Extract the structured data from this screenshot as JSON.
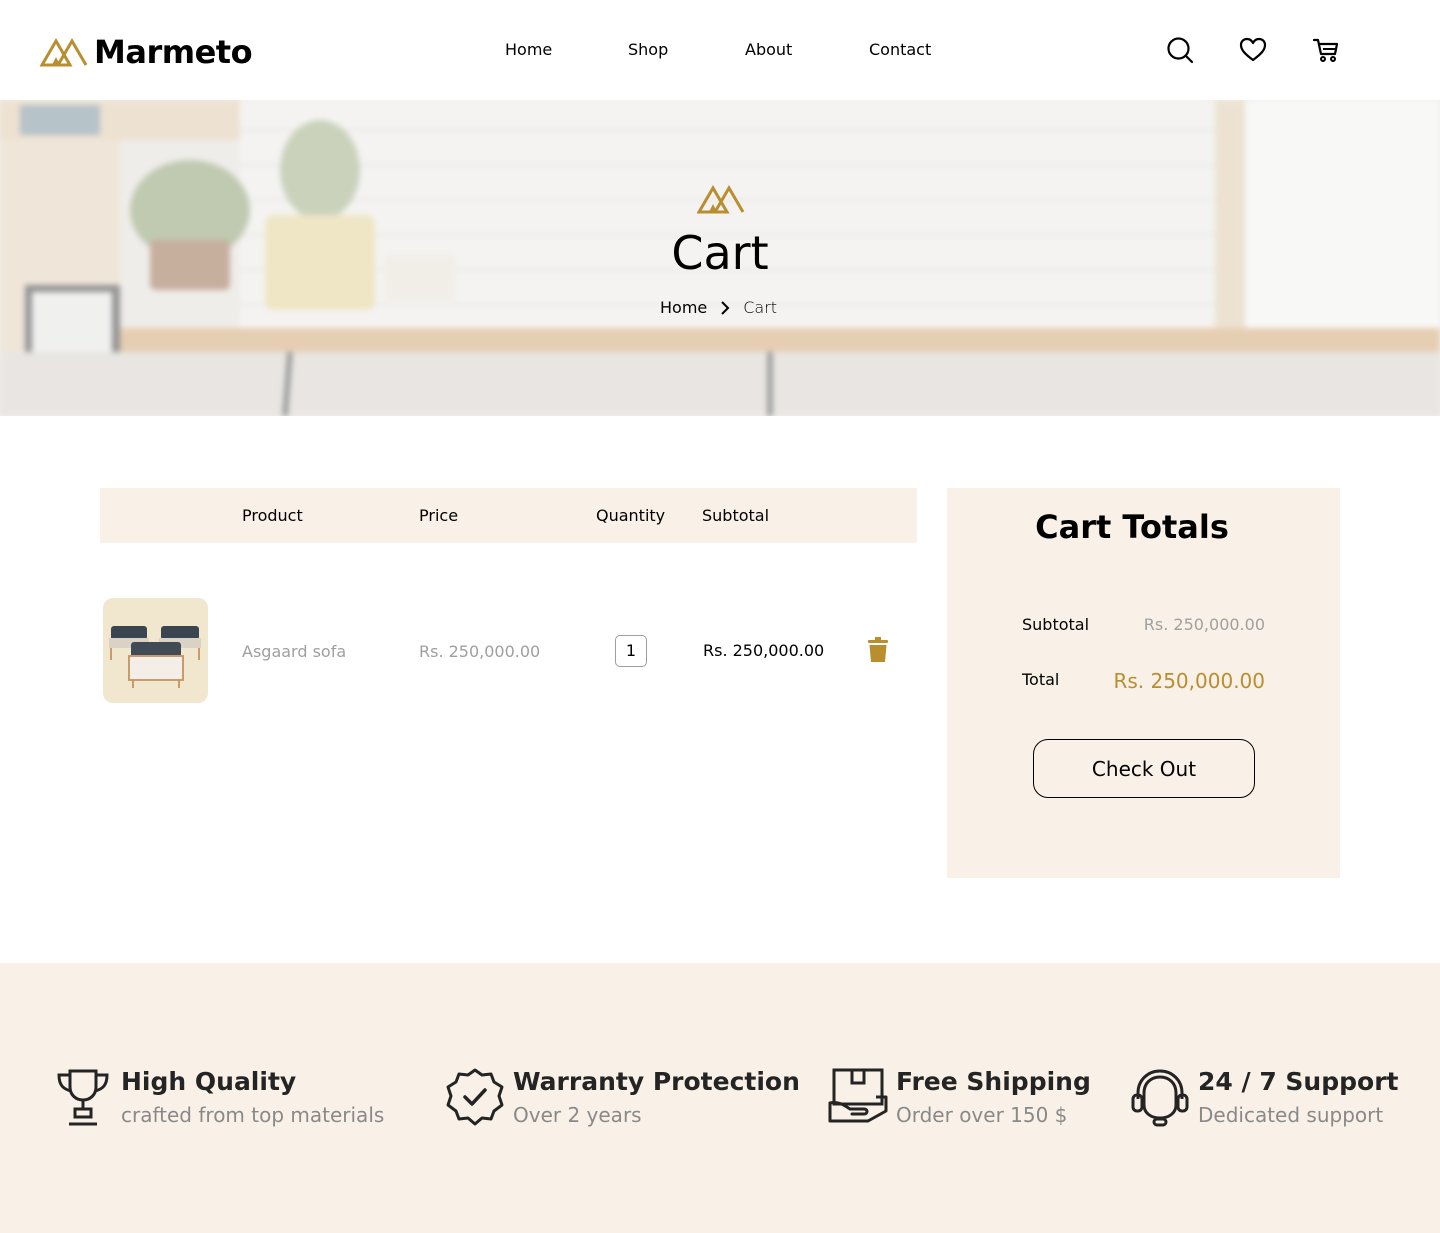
{
  "brand": {
    "name": "Marmeto",
    "accent": "#B88E2F"
  },
  "nav": [
    {
      "label": "Home"
    },
    {
      "label": "Shop"
    },
    {
      "label": "About"
    },
    {
      "label": "Contact"
    }
  ],
  "header_icons": [
    "search-icon",
    "heart-icon",
    "cart-icon"
  ],
  "hero": {
    "title": "Cart",
    "breadcrumb": {
      "home": "Home",
      "current": "Cart"
    }
  },
  "cart_table": {
    "headers": {
      "product": "Product",
      "price": "Price",
      "quantity": "Quantity",
      "subtotal": "Subtotal"
    },
    "items": [
      {
        "name": "Asgaard sofa",
        "price": "Rs. 250,000.00",
        "quantity": "1",
        "subtotal": "Rs. 250,000.00"
      }
    ]
  },
  "totals": {
    "title": "Cart Totals",
    "subtotal_label": "Subtotal",
    "subtotal_value": "Rs. 250,000.00",
    "total_label": "Total",
    "total_value": "Rs. 250,000.00",
    "checkout_label": "Check Out"
  },
  "features": [
    {
      "icon": "trophy-icon",
      "title": "High Quality",
      "subtitle": "crafted from top materials"
    },
    {
      "icon": "badge-check-icon",
      "title": "Warranty Protection",
      "subtitle": "Over 2 years"
    },
    {
      "icon": "shipping-box-icon",
      "title": "Free Shipping",
      "subtitle": "Order over 150 $"
    },
    {
      "icon": "headset-icon",
      "title": "24 / 7 Support",
      "subtitle": "Dedicated support"
    }
  ],
  "colors": {
    "panel_bg": "#F9F1E7",
    "muted_text": "#9F9F9F",
    "feature_sub": "#898989"
  }
}
